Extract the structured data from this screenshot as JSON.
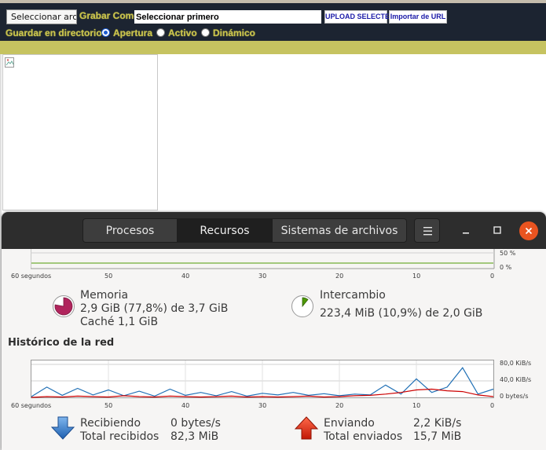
{
  "web": {
    "file_button": "Seleccionar arc",
    "save_as_label": "Grabar Como",
    "name_value": "Seleccionar primero",
    "upload_button": "UPLOAD SELECTED",
    "import_button": "Importar de URL",
    "save_dir_label": "Guardar en directorio",
    "radio_options": [
      {
        "label": "Apertura",
        "checked": true
      },
      {
        "label": "Activo",
        "checked": false
      },
      {
        "label": "Dinámico",
        "checked": false
      }
    ]
  },
  "monitor": {
    "tabs": [
      "Procesos",
      "Recursos",
      "Sistemas de archivos"
    ],
    "active_tab": "Recursos",
    "memory_chart": {
      "right_ticks": [
        "50 %",
        "0 %"
      ],
      "x_ticks": [
        "60 segundos",
        "50",
        "40",
        "30",
        "20",
        "10",
        "0"
      ]
    },
    "memory": {
      "label": "Memoria",
      "value": "2,9 GiB (77,8%) de 3,7 GiB",
      "cache": "Caché 1,1 GiB",
      "fraction": 0.778,
      "color": "#b0245c"
    },
    "swap": {
      "label": "Intercambio",
      "value": "223,4 MiB (10,9%) de 2,0 GiB",
      "fraction": 0.109,
      "color": "#4e9a06"
    },
    "network_title": "Histórico de la red",
    "network": {
      "receiving_label": "Recibiendo",
      "receiving_value": "0 bytes/s",
      "total_received_label": "Total recibidos",
      "total_received_value": "82,3 MiB",
      "sending_label": "Enviando",
      "sending_value": "2,2 KiB/s",
      "total_sent_label": "Total enviados",
      "total_sent_value": "15,7 MiB"
    }
  },
  "chart_data": {
    "type": "line",
    "x": [
      60,
      58,
      56,
      54,
      52,
      50,
      48,
      46,
      44,
      42,
      40,
      38,
      36,
      34,
      32,
      30,
      28,
      26,
      24,
      22,
      20,
      18,
      16,
      14,
      12,
      10,
      8,
      6,
      4,
      2,
      0
    ],
    "xlabel": "",
    "ylabel": "",
    "ylim": [
      0,
      80
    ],
    "y_ticks": [
      "80,0 KiB/s",
      "40,0 KiB/s",
      "0 bytes/s"
    ],
    "x_ticks": [
      "60 segundos",
      "50",
      "40",
      "30",
      "20",
      "10",
      "0"
    ],
    "grid": true,
    "series": [
      {
        "color": "#1f6fb5",
        "values": [
          2,
          25,
          5,
          22,
          6,
          18,
          4,
          15,
          3,
          20,
          5,
          12,
          4,
          14,
          3,
          10,
          6,
          12,
          5,
          9,
          4,
          8,
          6,
          30,
          8,
          45,
          12,
          25,
          72,
          8,
          20
        ]
      },
      {
        "color": "#cc0000",
        "values": [
          0,
          2,
          1,
          3,
          2,
          1,
          4,
          2,
          1,
          3,
          2,
          1,
          2,
          3,
          1,
          2,
          1,
          2,
          3,
          1,
          2,
          4,
          5,
          8,
          12,
          18,
          20,
          16,
          14,
          6,
          2
        ]
      }
    ]
  }
}
